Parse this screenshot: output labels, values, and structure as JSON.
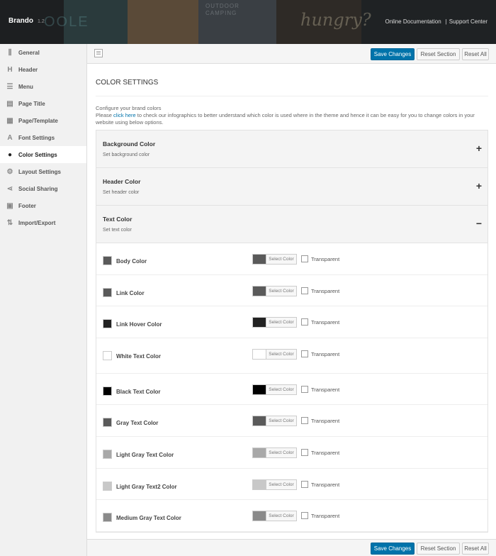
{
  "header": {
    "brand": "Brando",
    "version": "1.2",
    "links": [
      "Online Documentation",
      "|",
      "Support Center"
    ],
    "bg_text_1": "OUTDOOR",
    "bg_text_2": "CAMPING",
    "bg_text_3": "hungry?",
    "bg_text_4": "OOLE"
  },
  "sidebar": {
    "items": [
      {
        "label": "General",
        "icon": "sliders-icon",
        "glyph": "⫼"
      },
      {
        "label": "Header",
        "icon": "heading-icon",
        "glyph": "H"
      },
      {
        "label": "Menu",
        "icon": "menu-icon",
        "glyph": "☰"
      },
      {
        "label": "Page Title",
        "icon": "page-icon",
        "glyph": "▤"
      },
      {
        "label": "Page/Template",
        "icon": "template-icon",
        "glyph": "▦"
      },
      {
        "label": "Font Settings",
        "icon": "font-icon",
        "glyph": "A"
      },
      {
        "label": "Color Settings",
        "icon": "drop-icon",
        "glyph": "●"
      },
      {
        "label": "Layout Settings",
        "icon": "gears-icon",
        "glyph": "⚙"
      },
      {
        "label": "Social Sharing",
        "icon": "share-icon",
        "glyph": "⋖"
      },
      {
        "label": "Footer",
        "icon": "footer-icon",
        "glyph": "▣"
      },
      {
        "label": "Import/Export",
        "icon": "import-export-icon",
        "glyph": "⇅"
      }
    ],
    "active_index": 6
  },
  "toolbar": {
    "save_label": "Save Changes",
    "reset_section_label": "Reset Section",
    "reset_all_label": "Reset All"
  },
  "section": {
    "title": "COLOR SETTINGS",
    "line1": "Configure your brand colors",
    "line2_pre": "Please ",
    "link": "click here",
    "line2_post": " to check our infographics to better understand which color is used where in the theme and hence it can be easy for you to change colors in your website using below options."
  },
  "accordions": [
    {
      "title": "Background Color",
      "subtitle": "Set background color",
      "toggle": "+"
    },
    {
      "title": "Header Color",
      "subtitle": "Set header color",
      "toggle": "+"
    },
    {
      "title": "Text Color",
      "subtitle": "Set text color",
      "toggle": "−"
    }
  ],
  "picker": {
    "select_label": "Select Color",
    "transparent_label": "Transparent"
  },
  "colors": [
    {
      "label": "Body Color",
      "value": "#5a5a5a"
    },
    {
      "label": "Link Color",
      "value": "#5a5a5a"
    },
    {
      "label": "Link Hover Color",
      "value": "#222222"
    },
    {
      "label": "White Text Color",
      "value": "#ffffff"
    },
    {
      "label": "Black Text Color",
      "value": "#000000"
    },
    {
      "label": "Gray Text Color",
      "value": "#5a5a5a"
    },
    {
      "label": "Light Gray Text Color",
      "value": "#a8a8a8"
    },
    {
      "label": "Light Gray Text2 Color",
      "value": "#c8c8c8"
    },
    {
      "label": "Medium Gray Text Color",
      "value": "#8a8a8a"
    }
  ]
}
